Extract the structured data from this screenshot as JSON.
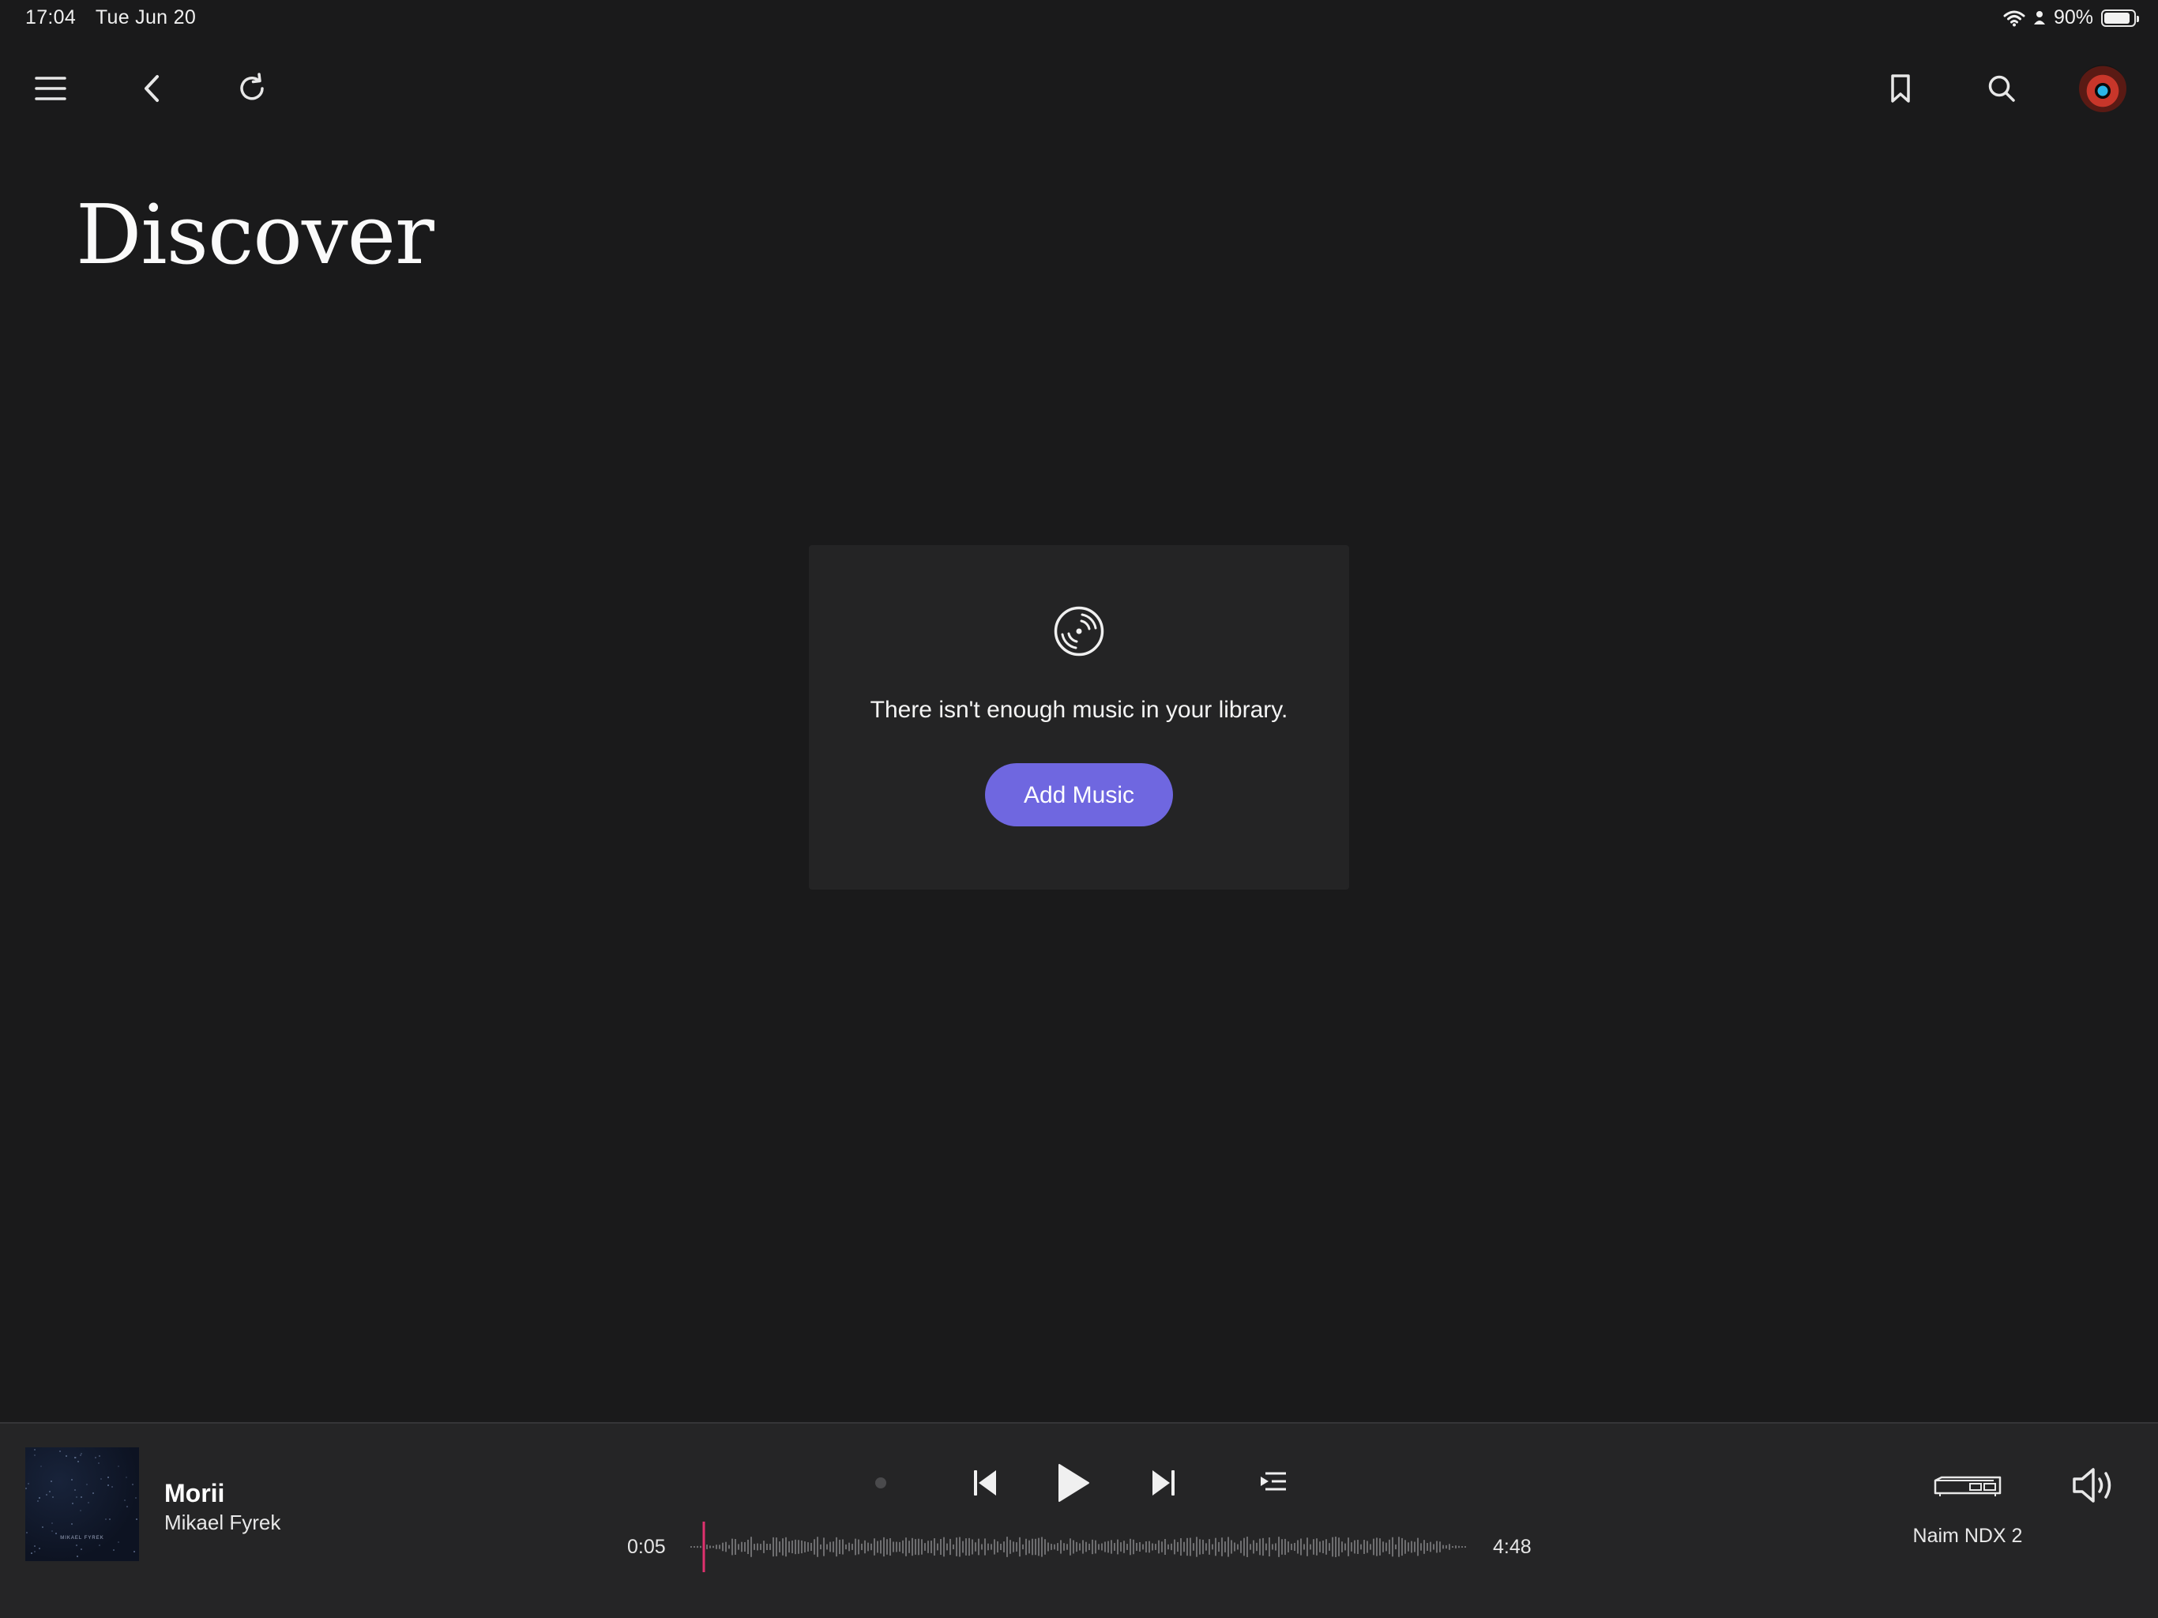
{
  "status_bar": {
    "time": "17:04",
    "date": "Tue Jun 20",
    "battery_percent": "90%",
    "battery_level": 0.9
  },
  "toolbar": {
    "menu_icon": "menu-icon",
    "back_icon": "back-chevron-icon",
    "refresh_icon": "refresh-icon",
    "bookmark_icon": "bookmark-icon",
    "search_icon": "search-icon",
    "avatar": "user-avatar"
  },
  "page": {
    "title": "Discover"
  },
  "empty_state": {
    "icon": "vinyl-disc-icon",
    "message": "There isn't enough music in your library.",
    "button_label": "Add Music"
  },
  "player": {
    "album_art_text": "MIKAEL FYREK",
    "track_title": "Morii",
    "track_artist": "Mikael Fyrek",
    "elapsed": "0:05",
    "duration": "4:48",
    "progress": 0.017,
    "device_name": "Naim NDX 2",
    "accent_color": "#e0316e"
  },
  "colors": {
    "background": "#1a1a1b",
    "card": "#242425",
    "button": "#6f67e0",
    "player_bar": "#252526"
  }
}
